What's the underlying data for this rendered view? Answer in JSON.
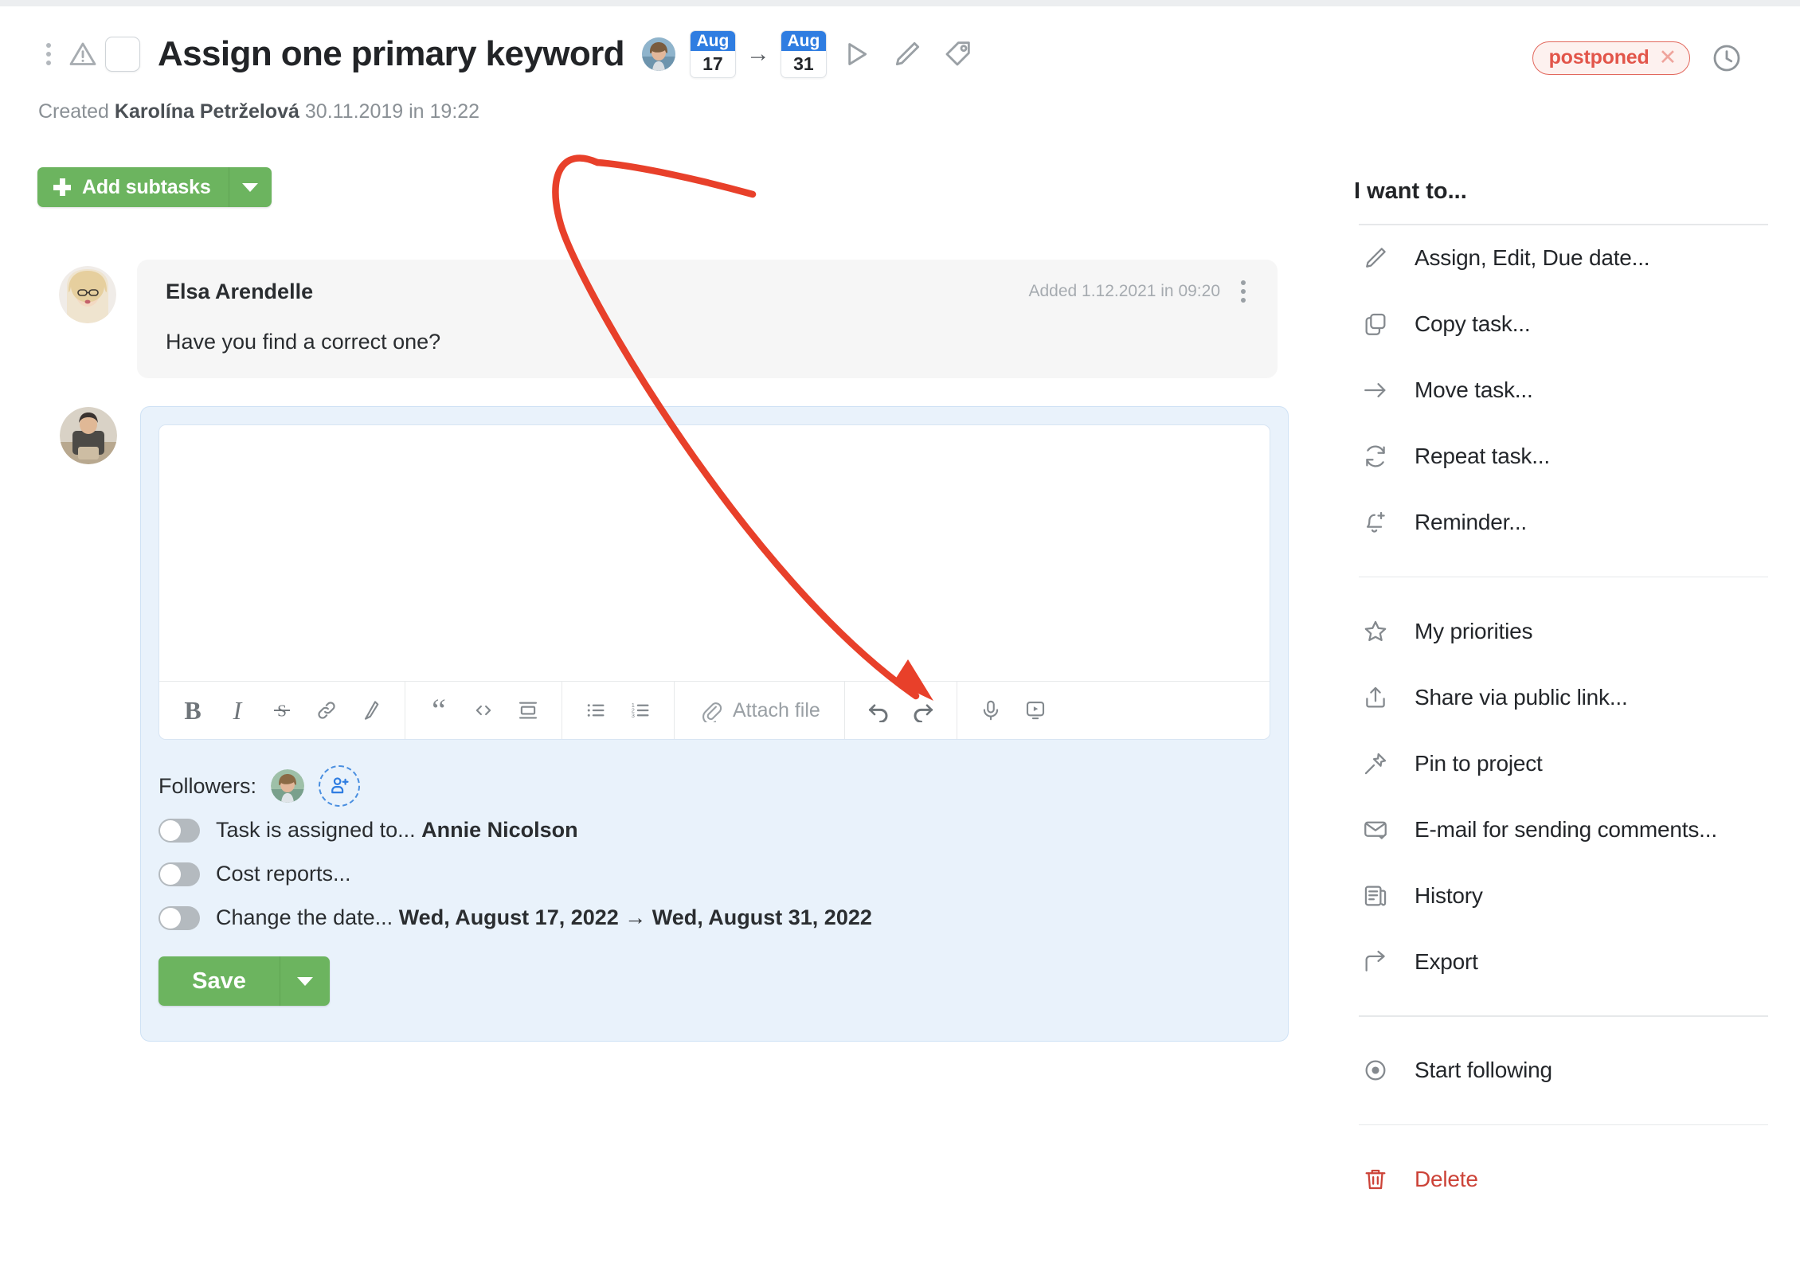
{
  "header": {
    "title": "Assign one primary keyword",
    "date_from": {
      "month": "Aug",
      "day": "17"
    },
    "date_to": {
      "month": "Aug",
      "day": "31"
    },
    "arrow": "→",
    "status_badge": "postponed",
    "status_close": "✕",
    "created_prefix": "Created",
    "created_author": "Karolína Petrželová",
    "created_datetime": "30.11.2019 in 19:22"
  },
  "toolbar_top": {
    "add_subtasks_label": "Add subtasks"
  },
  "comment": {
    "author": "Elsa Arendelle",
    "added": "Added 1.12.2021 in 09:20",
    "body": "Have you find a correct one?"
  },
  "editor": {
    "text_value": "",
    "placeholder": "",
    "attach_label": "Attach file",
    "tools": [
      {
        "name": "bold-icon",
        "glyph": "B"
      },
      {
        "name": "italic-icon",
        "glyph": "I"
      },
      {
        "name": "strikethrough-icon",
        "glyph": "S"
      },
      {
        "name": "link-icon",
        "glyph": ""
      },
      {
        "name": "highlight-icon",
        "glyph": ""
      },
      {
        "name": "quote-icon",
        "glyph": "❝"
      },
      {
        "name": "code-icon",
        "glyph": "<>"
      },
      {
        "name": "block-icon",
        "glyph": ""
      },
      {
        "name": "bullet-list-icon",
        "glyph": ""
      },
      {
        "name": "numbered-list-icon",
        "glyph": ""
      },
      {
        "name": "attach-file-icon",
        "glyph": ""
      },
      {
        "name": "undo-icon",
        "glyph": ""
      },
      {
        "name": "redo-icon",
        "glyph": ""
      },
      {
        "name": "microphone-icon",
        "glyph": ""
      },
      {
        "name": "video-icon",
        "glyph": ""
      }
    ],
    "followers_label": "Followers:",
    "toggles": [
      {
        "label": "Task is assigned to...",
        "value": "Annie Nicolson",
        "on": false
      },
      {
        "label": "Cost reports...",
        "value": "",
        "on": false
      },
      {
        "label": "Change the date...",
        "value": "Wed, August 17, 2022 → Wed, August 31, 2022",
        "on": false
      }
    ],
    "save_label": "Save"
  },
  "panel": {
    "title": "I want to...",
    "groups": [
      [
        {
          "icon": "pencil-icon",
          "label": "Assign, Edit, Due date..."
        },
        {
          "icon": "copy-icon",
          "label": "Copy task..."
        },
        {
          "icon": "arrow-right-icon",
          "label": "Move task..."
        },
        {
          "icon": "repeat-icon",
          "label": "Repeat task..."
        },
        {
          "icon": "bell-plus-icon",
          "label": "Reminder..."
        }
      ],
      [
        {
          "icon": "star-icon",
          "label": "My priorities"
        },
        {
          "icon": "share-icon",
          "label": "Share via public link..."
        },
        {
          "icon": "pin-icon",
          "label": "Pin to project"
        },
        {
          "icon": "envelope-check-icon",
          "label": "E-mail for sending comments..."
        },
        {
          "icon": "history-icon",
          "label": "History"
        },
        {
          "icon": "export-icon",
          "label": "Export"
        }
      ],
      [
        {
          "icon": "eye-icon",
          "label": "Start following"
        }
      ],
      [
        {
          "icon": "trash-icon",
          "label": "Delete",
          "danger": true
        }
      ]
    ]
  },
  "colors": {
    "green": "#6cb45f",
    "blue": "#2f7de1",
    "red_status": "#e2554a",
    "danger": "#cc4338",
    "annotation": "#e8402a",
    "editor_bg": "#e9f2fb"
  }
}
